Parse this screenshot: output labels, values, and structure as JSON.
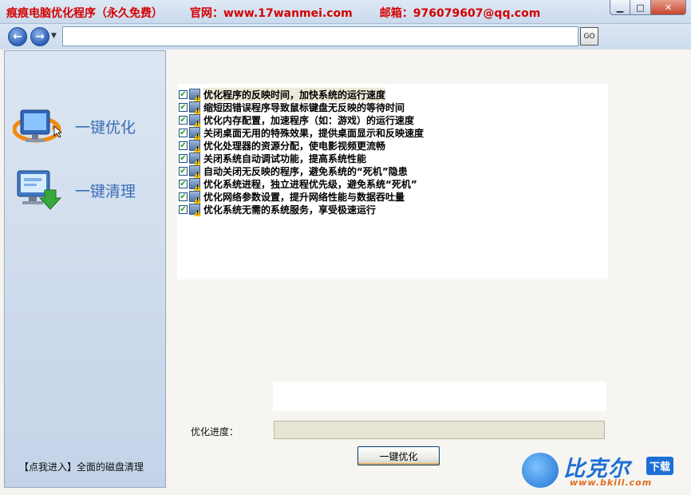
{
  "window": {
    "title_name": "痕痕电脑优化程序（永久免费）",
    "title_site": "官网：www.17wanmei.com",
    "title_email": "邮箱：976079607@qq.com",
    "controls": {
      "minimize": "▁",
      "maximize": "□",
      "close": "✕"
    }
  },
  "navbar": {
    "address_value": "",
    "go_label": "GO"
  },
  "sidebar": {
    "items": [
      {
        "label": "一键优化",
        "icon": "optimize-monitor-icon"
      },
      {
        "label": "一键清理",
        "icon": "clean-monitor-icon"
      }
    ],
    "link_text": "【点我进入】全面的磁盘清理"
  },
  "options": [
    {
      "text": "优化程序的反映时间，加快系统的运行速度",
      "checked": true
    },
    {
      "text": "缩短因错误程序导致鼠标键盘无反映的等待时间",
      "checked": true
    },
    {
      "text": "优化内存配置，加速程序（如：游戏）的运行速度",
      "checked": true
    },
    {
      "text": "关闭桌面无用的特殊效果，提供桌面显示和反映速度",
      "checked": true
    },
    {
      "text": "优化处理器的资源分配，使电影视频更流畅",
      "checked": true
    },
    {
      "text": "关闭系统自动调试功能，提高系统性能",
      "checked": true
    },
    {
      "text": "自动关闭无反映的程序，避免系统的“死机”隐患",
      "checked": true
    },
    {
      "text": "优化系统进程，独立进程优先级，避免系统“死机”",
      "checked": true
    },
    {
      "text": "优化网络参数设置，提升网络性能与数据吞吐量",
      "checked": true
    },
    {
      "text": "优化系统无需的系统服务，享受极速运行",
      "checked": true
    }
  ],
  "progress": {
    "label": "优化进度：",
    "value": 0
  },
  "action_button": "一键优化",
  "watermark": {
    "name": "比克尔",
    "tag": "下载",
    "url": "www.bkill.com"
  }
}
